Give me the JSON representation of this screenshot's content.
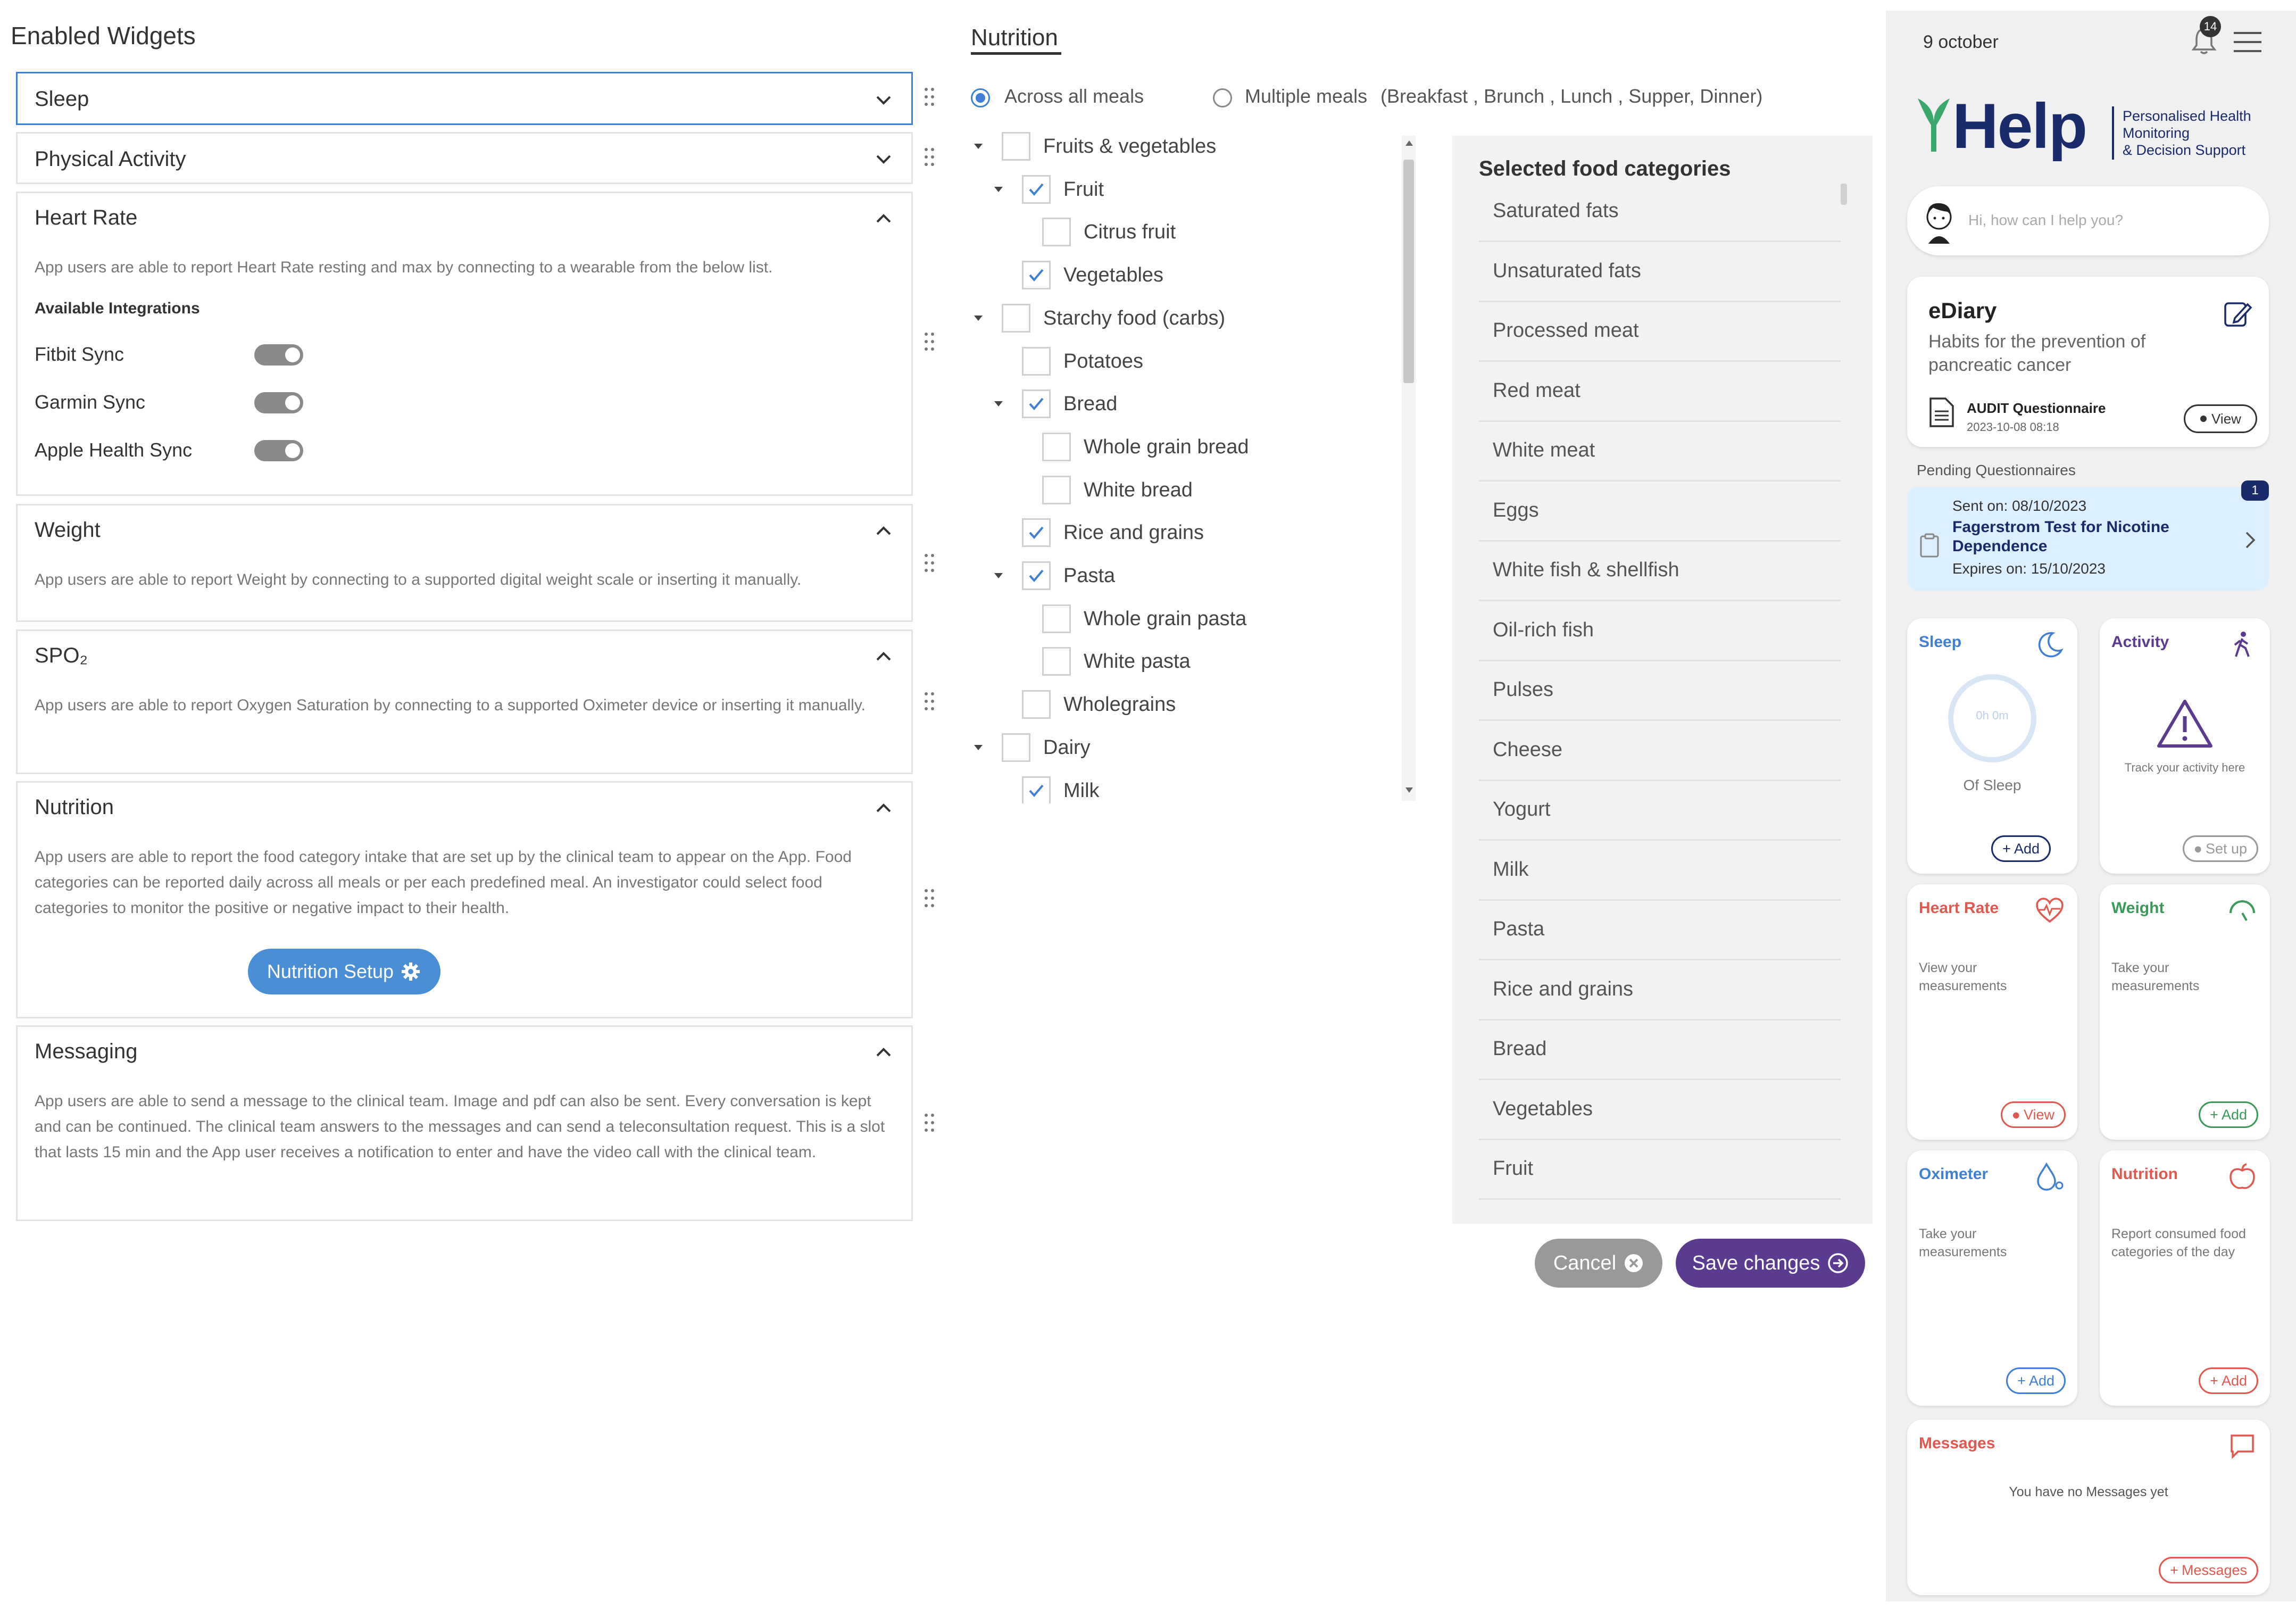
{
  "left": {
    "title": "Enabled Widgets",
    "sleep": {
      "title": "Sleep"
    },
    "physical_activity": {
      "title": "Physical Activity"
    },
    "heart_rate": {
      "title": "Heart Rate",
      "description": "App users are able to report Heart Rate resting and max by connecting to a wearable from the below list.",
      "integrations_label": "Available Integrations",
      "integrations": [
        {
          "label": "Fitbit Sync"
        },
        {
          "label": "Garmin Sync"
        },
        {
          "label": "Apple Health Sync"
        }
      ]
    },
    "weight": {
      "title": "Weight",
      "description": "App users are able to report Weight by connecting to a supported digital weight scale or inserting it manually."
    },
    "spo2": {
      "title": "SPO₂",
      "description": "App users are able to report Oxygen Saturation by connecting to a supported Oximeter device or inserting it manually."
    },
    "nutrition": {
      "title": "Nutrition",
      "description": "App users are able to report the food category intake that are set up by the clinical team to appear on the App. Food categories can be reported daily across all meals or per each predefined meal. An investigator could select food categories to monitor the positive or negative impact to their health.",
      "setup_button": "Nutrition Setup"
    },
    "messaging": {
      "title": "Messaging",
      "description": "App users are able to send a message to the clinical team. Image and pdf can also be sent. Every conversation is kept and can be continued. The clinical team answers to the messages and can send a teleconsultation request. This is a slot that lasts 15 min and the App user receives a notification to enter and have the video call with the clinical team."
    }
  },
  "middle": {
    "title": "Nutrition",
    "radio_all": "Across all meals",
    "radio_multiple": "Multiple meals",
    "radio_multiple_detail": "(Breakfast , Brunch , Lunch , Supper, Dinner)",
    "tree": [
      {
        "label": "Fruits & vegetables",
        "level": 0,
        "caret": true,
        "checked": false
      },
      {
        "label": "Fruit",
        "level": 1,
        "caret": true,
        "checked": true
      },
      {
        "label": "Citrus fruit",
        "level": 2,
        "caret": false,
        "checked": false
      },
      {
        "label": "Vegetables",
        "level": 1,
        "caret": false,
        "checked": true
      },
      {
        "label": "Starchy food (carbs)",
        "level": 0,
        "caret": true,
        "checked": false
      },
      {
        "label": "Potatoes",
        "level": 1,
        "caret": false,
        "checked": false
      },
      {
        "label": "Bread",
        "level": 1,
        "caret": true,
        "checked": true
      },
      {
        "label": "Whole grain bread",
        "level": 2,
        "caret": false,
        "checked": false
      },
      {
        "label": "White bread",
        "level": 2,
        "caret": false,
        "checked": false
      },
      {
        "label": "Rice and grains",
        "level": 1,
        "caret": false,
        "checked": true
      },
      {
        "label": "Pasta",
        "level": 1,
        "caret": true,
        "checked": true
      },
      {
        "label": "Whole grain pasta",
        "level": 2,
        "caret": false,
        "checked": false
      },
      {
        "label": "White pasta",
        "level": 2,
        "caret": false,
        "checked": false
      },
      {
        "label": "Wholegrains",
        "level": 1,
        "caret": false,
        "checked": false
      },
      {
        "label": "Dairy",
        "level": 0,
        "caret": true,
        "checked": false
      },
      {
        "label": "Milk",
        "level": 1,
        "caret": false,
        "checked": true
      }
    ],
    "selected_title": "Selected food categories",
    "selected": [
      "Saturated fats",
      "Unsaturated fats",
      "Processed meat",
      "Red meat",
      "White meat",
      "Eggs",
      "White fish & shellfish",
      "Oil-rich fish",
      "Pulses",
      "Cheese",
      "Yogurt",
      "Milk",
      "Pasta",
      "Rice and grains",
      "Bread",
      "Vegetables",
      "Fruit"
    ],
    "cancel": "Cancel",
    "save": "Save changes"
  },
  "phone": {
    "date": "9 october",
    "bell_count": "14",
    "logo": "Help",
    "tagline1": "Personalised Health",
    "tagline2": "Monitoring",
    "tagline3": "& Decision Support",
    "chat_placeholder": "Hi, how can I help you?",
    "ediary": {
      "title": "eDiary",
      "subtitle": "Habits for the prevention of pancreatic cancer",
      "audit_title": "AUDIT Questionnaire",
      "audit_date": "2023-10-08 08:18",
      "view": "View"
    },
    "pending_label": "Pending Questionnaires",
    "pending": {
      "badge": "1",
      "sent": "Sent on: 08/10/2023",
      "title": "Fagerstrom Test for Nicotine Dependence",
      "expires": "Expires on: 15/10/2023"
    },
    "sleep": {
      "title": "Sleep",
      "value": "0h 0m",
      "caption": "Of Sleep",
      "button": "Add"
    },
    "activity": {
      "title": "Activity",
      "text": "Track your activity here",
      "button": "Set up"
    },
    "heart": {
      "title": "Heart Rate",
      "text": "View your measurements",
      "button": "View"
    },
    "weight": {
      "title": "Weight",
      "text": "Take your measurements",
      "button": "Add"
    },
    "oximeter": {
      "title": "Oximeter",
      "text": "Take your measurements",
      "button": "Add"
    },
    "nutrition": {
      "title": "Nutrition",
      "text": "Report consumed food categories of the day",
      "button": "Add"
    },
    "messages": {
      "title": "Messages",
      "text": "You have no Messages yet",
      "button": "Messages"
    },
    "colors": {
      "blue": "#3f7fd4",
      "red": "#e0584f",
      "green": "#3a9a5a",
      "navy": "#1a2b6b",
      "purple": "#5a3b8f"
    }
  }
}
